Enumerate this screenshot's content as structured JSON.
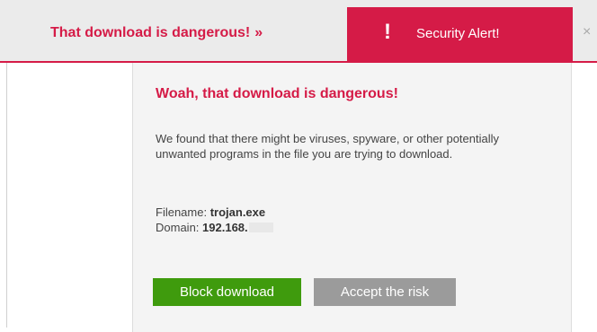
{
  "topbar": {
    "message": "That download is dangerous!",
    "arrow": "»",
    "alert_icon": "!",
    "alert_label": "Security Alert!",
    "close_glyph": "×"
  },
  "panel": {
    "title": "Woah, that download is dangerous!",
    "body": "We found that there might be viruses, spyware, or other potentially unwanted programs in the file you are trying to download.",
    "filename_label": "Filename:",
    "filename_value": "trojan.exe",
    "domain_label": "Domain:",
    "domain_value": "192.168.",
    "buttons": {
      "block": "Block download",
      "accept": "Accept the risk"
    }
  },
  "colors": {
    "accent": "#d51b47",
    "block_button": "#3f9b0d",
    "accept_button": "#9b9b9b",
    "panel_bg": "#f4f4f4",
    "topbar_bg": "#ebebeb"
  },
  "icons": {
    "alert": "exclamation-icon",
    "close": "close-icon"
  }
}
